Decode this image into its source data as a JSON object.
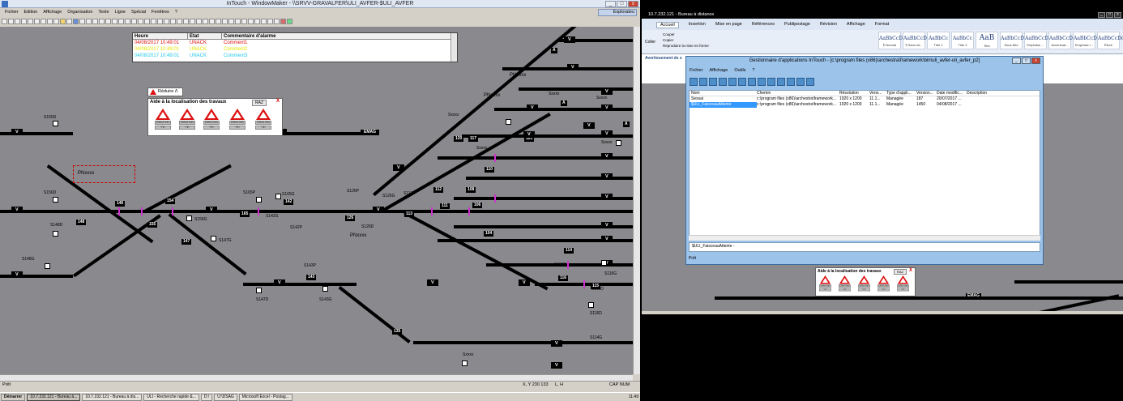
{
  "left_window": {
    "title": "InTouch - WindowMaker - \\\\SRVV-GRAVALFER\\ULI_AVFER-$ULI_AVFER",
    "menu": [
      "Fichier",
      "Edition",
      "Affichage",
      "Organisation",
      "Texte",
      "Ligne",
      "Spécial",
      "Fenêtres",
      "?"
    ],
    "explorer_label": "Explorateu",
    "status": {
      "left": "Prêt",
      "position": "X, Y  230     133",
      "size": "L, H",
      "caps": "CAP NUM"
    }
  },
  "alarm_table": {
    "headers": [
      "Heure",
      "Etat",
      "Commentaire d'alarme"
    ],
    "rows": [
      {
        "time": "04/08/2017 10:49:01",
        "state": "UNACK",
        "comment": "Comment1",
        "color": "#e01010"
      },
      {
        "time": "04/08/2017 10:49:01",
        "state": "UNACK",
        "comment": "Comment2",
        "color": "#e6e600"
      },
      {
        "time": "04/08/2017 10:49:01",
        "state": "UNACK",
        "comment": "Comment3",
        "color": "#20c8e6"
      }
    ]
  },
  "reduire_label": "Réduire Λ",
  "aid_panel": {
    "title": "Aide à la localisation des travaux",
    "raz": "RAZ",
    "close": "X",
    "btn1": "Début trav",
    "btn2": "Fin"
  },
  "schematic": {
    "labels": [
      "S155D",
      "S156D",
      "S148D",
      "S148G",
      "PNxxxx",
      "S165P",
      "S165G",
      "S156G",
      "S147G",
      "S142G",
      "S142P",
      "S126P",
      "S126G",
      "S126D",
      "S113P",
      "PNxxxx",
      "S143P",
      "S147D",
      "S143G",
      "Sxxxx",
      "PNxxxx",
      "S116P",
      "S116G",
      "S116D",
      "S114G",
      "S115D",
      "Sxxxx",
      "Sxxxx",
      "PNxxxx",
      "Sxxxx",
      "Sxxxx",
      "Sxxxx"
    ],
    "blocks": [
      "146",
      "154",
      "155",
      "147",
      "148",
      "165",
      "142",
      "126",
      "113",
      "112",
      "108",
      "111",
      "106",
      "104",
      "114",
      "116",
      "115",
      "110",
      "120",
      "117",
      "121",
      "135",
      "143",
      "EMAG"
    ],
    "v_signals": [
      "V",
      "V",
      "V",
      "V",
      "V",
      "V",
      "V",
      "V",
      "V",
      "V",
      "V",
      "V",
      "V",
      "V",
      "V",
      "V",
      "V",
      "V",
      "V",
      "V",
      "V",
      "V",
      "V",
      "V",
      "V",
      "V"
    ],
    "small_labels": [
      "A",
      "A",
      "A"
    ]
  },
  "taskbar": {
    "start": "Démarrer",
    "tasks": [
      "10.7.232.121 - Bureau à...",
      "10.7.232.121 - Bureau à dis...",
      "ULI - Recherche rapide &...",
      "D:\\",
      "U:\\DSAG",
      "Microsoft Excel - Postag..."
    ],
    "time": "11:49"
  },
  "right_window": {
    "title": "10.7.232.121 - Bureau à distance",
    "word_tabs": [
      "Accueil",
      "Insertion",
      "Mise en page",
      "Références",
      "Publipostage",
      "Révision",
      "Affichage",
      "Format"
    ],
    "clipboard": [
      "Couper",
      "Copier",
      "Reproduire la mise en forme"
    ],
    "paste": "Coller",
    "styles": [
      {
        "preview": "AaBbCcDc",
        "name": "¶ Normal"
      },
      {
        "preview": "AaBbCcDc",
        "name": "¶ Sans int..."
      },
      {
        "preview": "AaBbCc",
        "name": "Titre 1"
      },
      {
        "preview": "AaBbCc",
        "name": "Titre 2"
      },
      {
        "preview": "AaB",
        "name": "Titre"
      },
      {
        "preview": "AaBbCcDc",
        "name": "Sous-titre"
      },
      {
        "preview": "AaBbCcDc",
        "name": "Emphase ..."
      },
      {
        "preview": "AaBbCcDc",
        "name": "Accentuat..."
      },
      {
        "preview": "AaBbCcDc",
        "name": "Emphase i..."
      },
      {
        "preview": "AaBbCcDc",
        "name": "Élevé"
      }
    ],
    "notice": "Avertissement de s"
  },
  "manager": {
    "title": "Gestionnaire d'applications InTouch - [c:\\program files (x86)\\archestra\\framework\\bin\\uli_avfer-uli_avfer_p2]",
    "menu": [
      "Fichier",
      "Affichage",
      "Outils",
      "?"
    ],
    "columns": [
      "Nom",
      "Chemin",
      "Résolution",
      "Versi...",
      "Type d'appli...",
      "Version...",
      "Date modific...",
      "Description"
    ],
    "rows": [
      {
        "name": "Sessai",
        "path": "c:\\program files (x86)\\archestra\\framework...",
        "res": "1920 x 1200",
        "ver": "11.1...",
        "type": "Managée",
        "version": "187",
        "date": "20/07/2017 ...",
        "desc": "",
        "selected": false
      },
      {
        "name": "$ULI_FaisceauAttente",
        "path": "c:\\program files (x86)\\archestra\\framework...",
        "res": "1920 x 1200",
        "ver": "11.1...",
        "type": "Managée",
        "version": "1450",
        "date": "04/08/2017 ...",
        "desc": "",
        "selected": true
      }
    ],
    "path_field": "$ULI_FaisceauAttente -",
    "status": "Prêt"
  },
  "colors": {
    "canvas": "#8a8a8e",
    "track": "#000000",
    "accent_pink": "#d02fd0"
  }
}
